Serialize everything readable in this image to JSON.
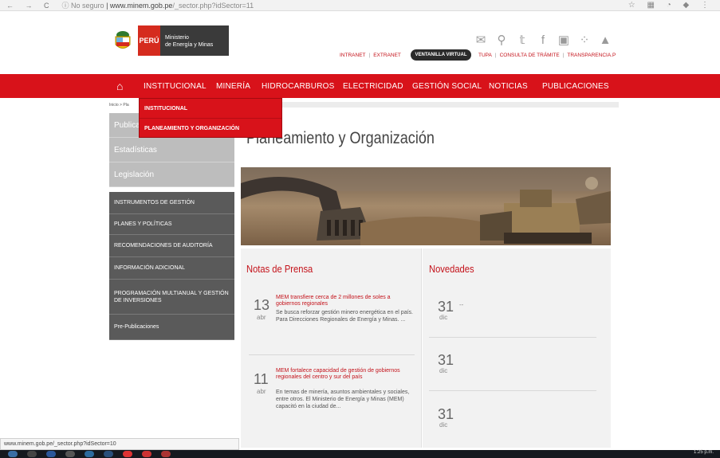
{
  "browser": {
    "nav_symbols": "← → C",
    "security": "ⓘ No seguro",
    "url_host": "www.minem.gob.pe",
    "url_path": "/_sector.php?idSector=11",
    "ext_icons": "☆ ▦ ◔ ◆ ⋮"
  },
  "header": {
    "logo_peru": "PERÚ",
    "logo_ministry_line1": "Ministerio",
    "logo_ministry_line2": "de Energía y Minas",
    "intranet": "INTRANET",
    "extranet": "EXTRANET",
    "ventanilla": "VENTANILLA VIRTUAL",
    "tupa": "TUPA",
    "consulta": "CONSULTA DE TRÁMITE",
    "transparencia": "TRANSPARENCIA.P",
    "separator": "|"
  },
  "nav": {
    "home_icon": "home-icon",
    "home_glyph": "⌂",
    "items": [
      "INSTITUCIONAL",
      "MINERÍA",
      "HIDROCARBUROS",
      "ELECTRICIDAD",
      "GESTIÓN SOCIAL",
      "NOTICIAS",
      "PUBLICACIONES"
    ]
  },
  "dropdown": {
    "items": [
      "INSTITUCIONAL",
      "PLANEAMIENTO Y ORGANIZACIÓN"
    ]
  },
  "breadcrumb": "Inicio > Pla",
  "sidebar": {
    "grey_items": [
      "Publica",
      "Estadísticas",
      "Legislación"
    ],
    "dark_items": [
      "INSTRUMENTOS DE GESTIÓN",
      "PLANES Y POLÍTICAS",
      "RECOMENDACIONES DE AUDITORÍA",
      "INFORMACIÓN ADICIONAL",
      "PROGRAMACIÓN MULTIANUAL Y GESTIÓN DE INVERSIONES",
      "Pre-Publicaciones"
    ]
  },
  "main": {
    "title": "Planeamiento y Organización",
    "notas_title": "Notas de Prensa",
    "novedades_title": "Novedades",
    "news": [
      {
        "day": "13",
        "month": "abr",
        "headline": "MEM transfiere cerca de 2 millones de soles a gobiernos regionales",
        "body": "Se busca reforzar gestión minero energética en el país.   Para Direcciones Regionales de Energía y Minas.   ..."
      },
      {
        "day": "11",
        "month": "abr",
        "headline": "MEM fortalece capacidad de gestión de gobiernos regionales del centro y sur del país",
        "body": "En temas de minería, asuntos ambientales y sociales, entre otros.   El Ministerio de Energía y Minas (MEM) capacitó  en la ciudad de..."
      }
    ],
    "novedades": [
      {
        "day": "31",
        "month": "dic",
        "text": "--"
      },
      {
        "day": "31",
        "month": "dic",
        "text": ""
      },
      {
        "day": "31",
        "month": "dic",
        "text": ""
      }
    ]
  },
  "status_bar": "www.minem.gob.pe/_sector.php?idSector=10",
  "taskbar": {
    "clock": "1:25 p.m."
  },
  "colors": {
    "brand_red": "#d8121a",
    "sidebar_dark": "#5a5a5a",
    "sidebar_grey": "#bdbdbd"
  }
}
